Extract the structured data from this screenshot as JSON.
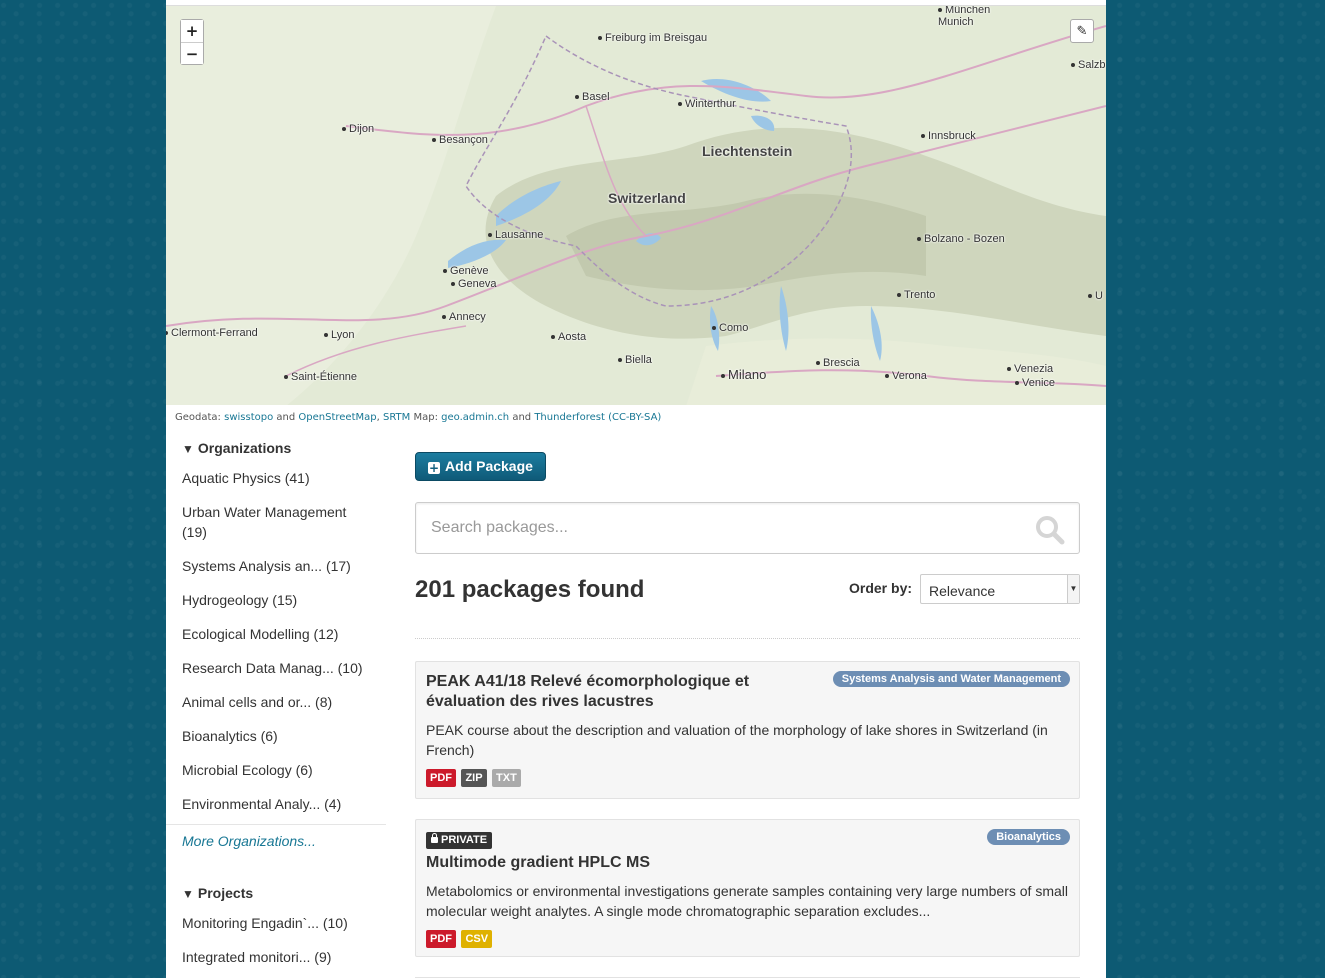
{
  "map": {
    "zoom_in": "+",
    "zoom_out": "−",
    "draw_icon": "✎",
    "places": [
      {
        "name": "München\nMunich",
        "kind": "city"
      },
      {
        "name": "Freiburg im Breisgau",
        "kind": "city"
      },
      {
        "name": "Salzb",
        "kind": "city"
      },
      {
        "name": "Basel",
        "kind": "city"
      },
      {
        "name": "Winterthur",
        "kind": "city"
      },
      {
        "name": "Dijon",
        "kind": "city"
      },
      {
        "name": "Besançon",
        "kind": "city"
      },
      {
        "name": "Innsbruck",
        "kind": "city"
      },
      {
        "name": "Liechtenstein",
        "kind": "country"
      },
      {
        "name": "Switzerland",
        "kind": "country"
      },
      {
        "name": "Lausanne",
        "kind": "city"
      },
      {
        "name": "Bolzano - Bozen",
        "kind": "city"
      },
      {
        "name": "Genève",
        "kind": "city"
      },
      {
        "name": "Geneva",
        "kind": "city"
      },
      {
        "name": "Trento",
        "kind": "city"
      },
      {
        "name": "U",
        "kind": "city"
      },
      {
        "name": "Annecy",
        "kind": "city"
      },
      {
        "name": "Clermont-Ferrand",
        "kind": "city"
      },
      {
        "name": "Lyon",
        "kind": "city"
      },
      {
        "name": "Aosta",
        "kind": "city"
      },
      {
        "name": "Como",
        "kind": "city"
      },
      {
        "name": "Biella",
        "kind": "city"
      },
      {
        "name": "Brescia",
        "kind": "city"
      },
      {
        "name": "Venezia",
        "kind": "city"
      },
      {
        "name": "Venice",
        "kind": "city"
      },
      {
        "name": "Saint-Étienne",
        "kind": "city"
      },
      {
        "name": "Milano",
        "kind": "city"
      },
      {
        "name": "Verona",
        "kind": "city"
      }
    ]
  },
  "attribution": {
    "geodata_prefix": "Geodata:",
    "swisstopo": "swisstopo",
    "and1": "and",
    "osm": "OpenStreetMap",
    "comma": ",",
    "srtm": "SRTM",
    "map_prefix": "Map:",
    "geoadmin": "geo.admin.ch",
    "and2": "and",
    "thunderforest": "Thunderforest",
    "license": "CC-BY-SA"
  },
  "organizations": {
    "title": "Organizations",
    "items": [
      "Aquatic Physics (41)",
      "Urban Water Management (19)",
      "Systems Analysis an... (17)",
      "Hydrogeology (15)",
      "Ecological Modelling (12)",
      "Research Data Manag... (10)",
      "Animal cells and or... (8)",
      "Bioanalytics (6)",
      "Microbial Ecology (6)",
      "Environmental Analy... (4)"
    ],
    "more": "More Organizations..."
  },
  "projects": {
    "title": "Projects",
    "items": [
      "Monitoring Engadin`... (10)",
      "Integrated monitori... (9)"
    ]
  },
  "main": {
    "add_package": "Add Package",
    "search_placeholder": "Search packages...",
    "results_count": "201 packages found",
    "order_label": "Order by:",
    "order_value": "Relevance",
    "datasets": [
      {
        "title": "PEAK A41/18 Relevé écomorphologique et évaluation des rives lacustres",
        "organization": "Systems Analysis and Water Management",
        "description": "PEAK course about the description and valuation of the morphology of lake shores in Switzerland (in French)",
        "formats": [
          "PDF",
          "ZIP",
          "TXT"
        ]
      },
      {
        "private_label": "PRIVATE",
        "title": "Multimode gradient HPLC MS",
        "organization": "Bioanalytics",
        "description": "Metabolomics or environmental investigations generate samples containing very large numbers of small molecular weight analytes. A single mode chromatographic separation excludes...",
        "formats": [
          "PDF",
          "CSV"
        ]
      }
    ]
  }
}
